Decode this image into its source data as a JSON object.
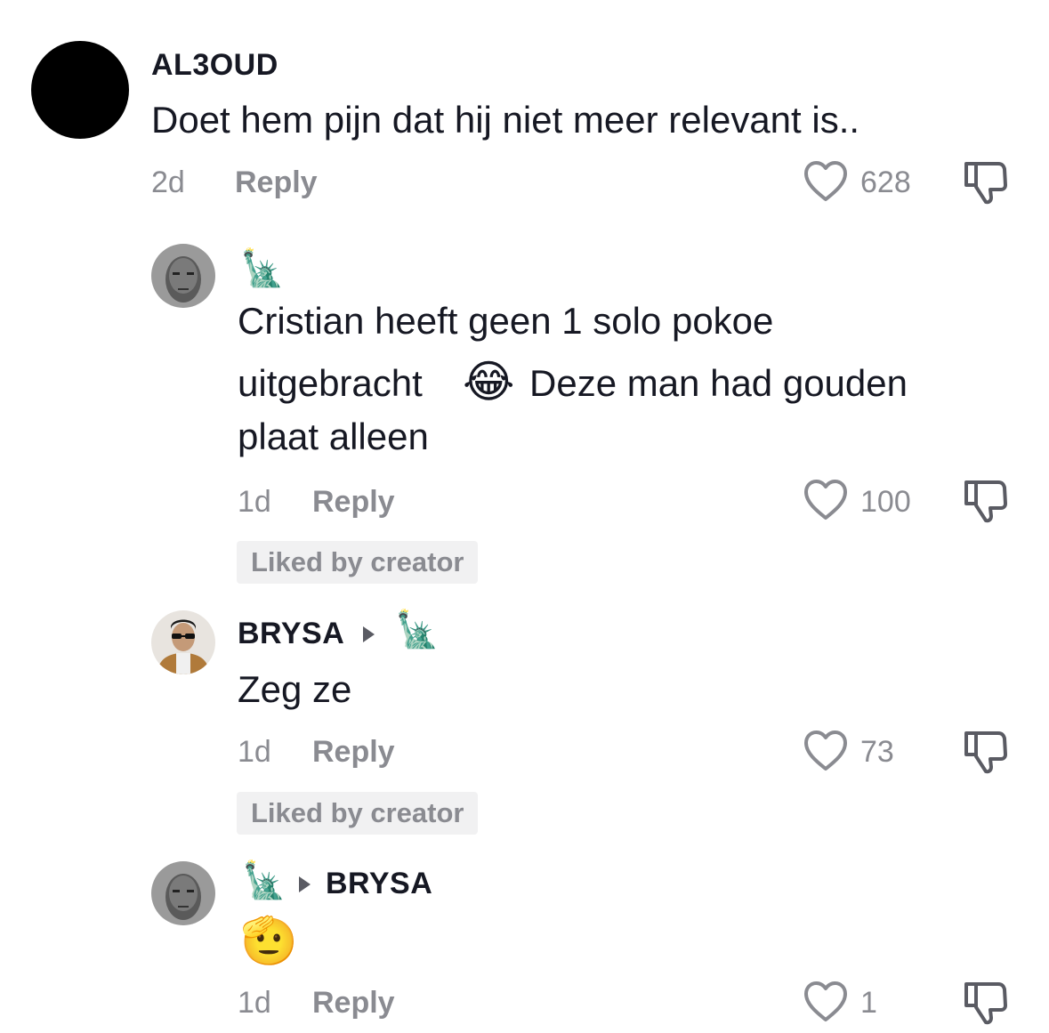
{
  "comments": [
    {
      "username": "AL3OUD",
      "text": "Doet hem pijn dat hij niet meer relevant is..",
      "time": "2d",
      "reply_label": "Reply",
      "likes": "628",
      "avatar": "black-circle"
    },
    {
      "username_emoji": "🗽",
      "text_line1": "Cristian heeft geen 1 solo pokoe",
      "text_line2a": "uitgebracht",
      "text_emoji": "😂",
      "text_line2b": "Deze man had gouden",
      "text_line3": "plaat alleen",
      "time": "1d",
      "reply_label": "Reply",
      "likes": "100",
      "badge": "Liked by creator",
      "avatar": "grayscale-face"
    },
    {
      "username": "BRYSA",
      "reply_to_emoji": "🗽",
      "text": "Zeg ze",
      "time": "1d",
      "reply_label": "Reply",
      "likes": "73",
      "badge": "Liked by creator",
      "avatar": "sunglasses-person"
    },
    {
      "username_emoji": "🗽",
      "reply_to": "BRYSA",
      "text_emoji": "🫡",
      "time": "1d",
      "reply_label": "Reply",
      "likes": "1",
      "avatar": "grayscale-face"
    }
  ],
  "colors": {
    "text": "#161823",
    "muted": "#8a8b91",
    "badge_bg": "#f1f1f2"
  },
  "icons": [
    "heart-icon",
    "dislike-icon",
    "reply-arrow-icon"
  ]
}
